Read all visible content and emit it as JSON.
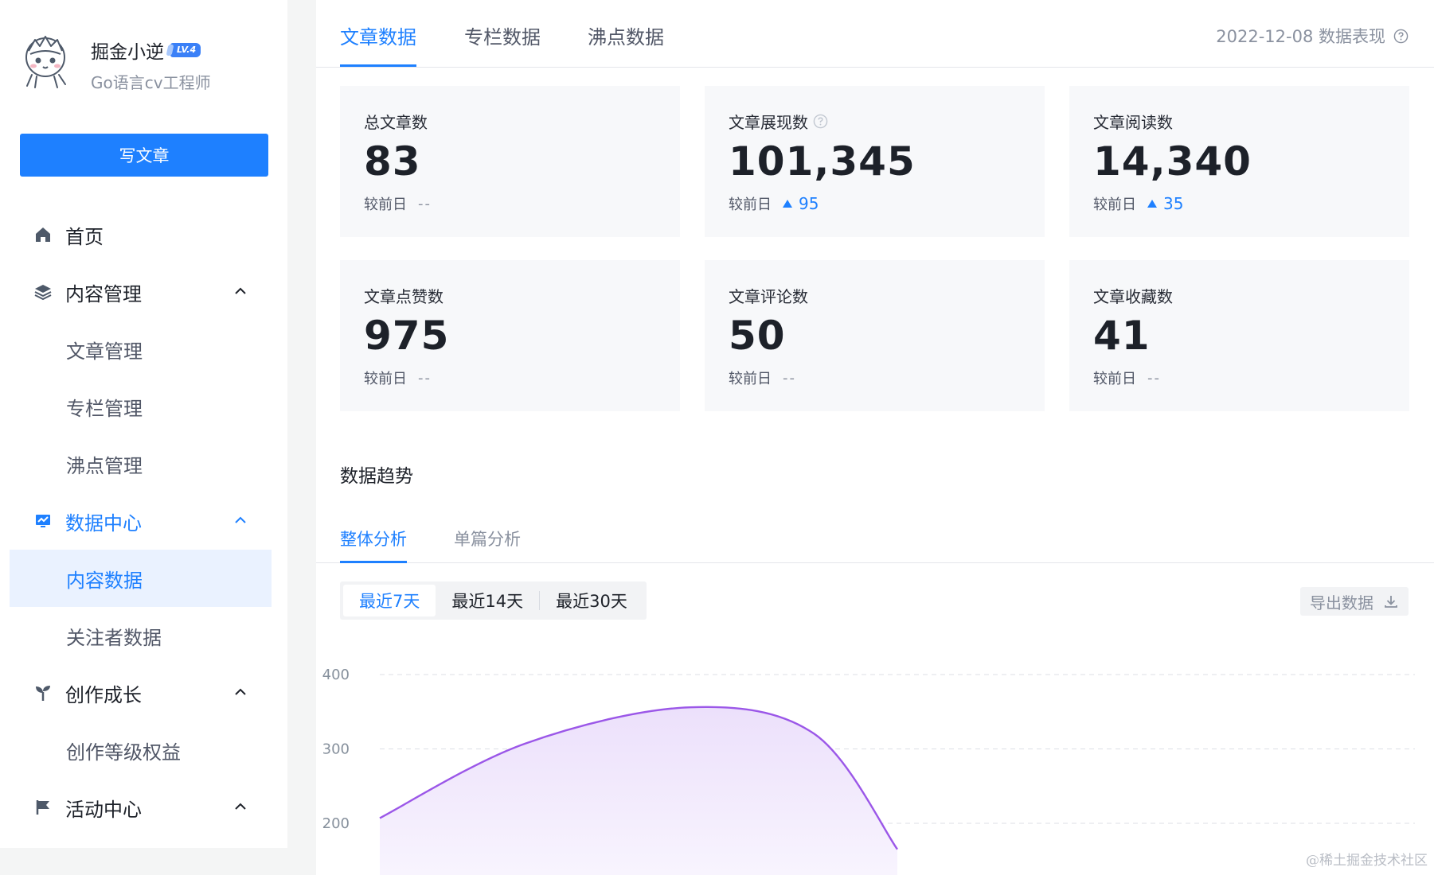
{
  "sidebar": {
    "profile": {
      "name": "掘金小逆",
      "level": "LV.4",
      "subtitle": "Go语言cv工程师"
    },
    "write_button": "写文章",
    "nav": {
      "home": "首页",
      "content_manage": "内容管理",
      "article_manage": "文章管理",
      "column_manage": "专栏管理",
      "pin_manage": "沸点管理",
      "data_center": "数据中心",
      "content_data": "内容数据",
      "follower_data": "关注者数据",
      "creation_growth": "创作成长",
      "level_rights": "创作等级权益",
      "activity_center": "活动中心"
    }
  },
  "tabs": {
    "items": [
      "文章数据",
      "专栏数据",
      "沸点数据"
    ],
    "active": 0,
    "date_info": "2022-12-08 数据表现"
  },
  "cards": [
    {
      "title": "总文章数",
      "value": "83",
      "compare_label": "较前日",
      "compare": "--",
      "trend": "none",
      "has_help": false
    },
    {
      "title": "文章展现数",
      "value": "101,345",
      "compare_label": "较前日",
      "compare": "95",
      "trend": "up",
      "has_help": true
    },
    {
      "title": "文章阅读数",
      "value": "14,340",
      "compare_label": "较前日",
      "compare": "35",
      "trend": "up",
      "has_help": false
    },
    {
      "title": "文章点赞数",
      "value": "975",
      "compare_label": "较前日",
      "compare": "--",
      "trend": "none",
      "has_help": false
    },
    {
      "title": "文章评论数",
      "value": "50",
      "compare_label": "较前日",
      "compare": "--",
      "trend": "none",
      "has_help": false
    },
    {
      "title": "文章收藏数",
      "value": "41",
      "compare_label": "较前日",
      "compare": "--",
      "trend": "none",
      "has_help": false
    }
  ],
  "trend": {
    "title": "数据趋势",
    "subtabs": [
      "整体分析",
      "单篇分析"
    ],
    "active_subtab": 0,
    "ranges": [
      "最近7天",
      "最近14天",
      "最近30天"
    ],
    "active_range": 0,
    "export_label": "导出数据"
  },
  "colors": {
    "accent": "#1e80ff",
    "line": "#9b57e8",
    "area": "#f3ecfd"
  },
  "chart_data": {
    "type": "area",
    "y_ticks": [
      "400",
      "300",
      "200"
    ],
    "ylim": [
      200,
      400
    ],
    "series": [
      {
        "points": [
          [
            0,
            207
          ],
          [
            0.14,
            307
          ],
          [
            0.3,
            356
          ],
          [
            0.42,
            320
          ],
          [
            0.5,
            165
          ]
        ]
      }
    ],
    "grid": "dashed-horizontal"
  },
  "watermark": "@稀土掘金技术社区"
}
